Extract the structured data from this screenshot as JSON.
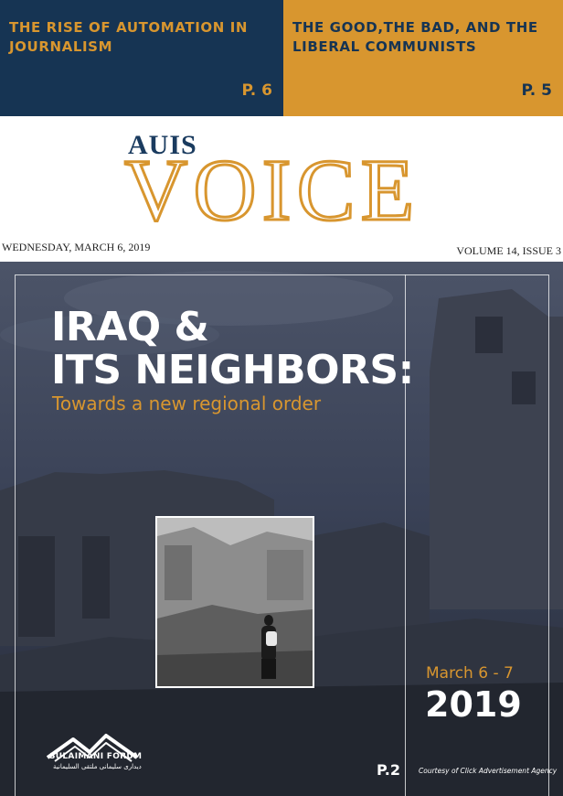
{
  "banner": {
    "left": {
      "title": "THE RISE OF AUTOMATION IN JOURNALISM",
      "page": "P. 6"
    },
    "right": {
      "title": "THE GOOD,THE BAD, AND THE LIBERAL COMMUNISTS",
      "page": "P. 5"
    }
  },
  "masthead": {
    "small": "AUIS",
    "large": "VOICE"
  },
  "issue": {
    "date": "WEDNESDAY, MARCH 6, 2019",
    "volume": "VOLUME 14, ISSUE 3"
  },
  "cover": {
    "headline_line1": "IRAQ &",
    "headline_line2": "ITS NEIGHBORS:",
    "subhead": "Towards a new regional order",
    "event_dates": "March 6 - 7",
    "event_year": "2019",
    "page_ref": "P.2",
    "credit": "Courtesy of Click Advertisement Agency",
    "forum_name": "SULAIMANI FORUM",
    "forum_arabic": "ديدارى سليمانى  ملتقى السليمانية"
  },
  "colors": {
    "navy": "#163453",
    "gold": "#d8962f"
  }
}
